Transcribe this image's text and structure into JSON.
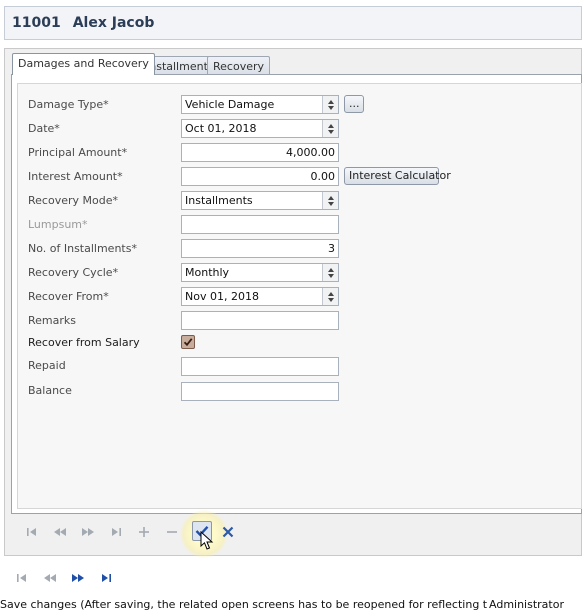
{
  "header": {
    "employee_id": "11001",
    "employee_name": "Alex Jacob"
  },
  "tabs": [
    {
      "label": "Damages and Recovery",
      "active": true
    },
    {
      "label": "Installments",
      "active": false
    },
    {
      "label": "Recovery",
      "active": false
    }
  ],
  "form": {
    "damage_type": {
      "label": "Damage Type*",
      "value": "Vehicle Damage",
      "browse_label": "..."
    },
    "date": {
      "label": "Date*",
      "value": "Oct 01, 2018"
    },
    "principal_amount": {
      "label": "Principal Amount*",
      "value": "4,000.00"
    },
    "interest_amount": {
      "label": "Interest Amount*",
      "value": "0.00",
      "button_label": "Interest Calculator"
    },
    "recovery_mode": {
      "label": "Recovery Mode*",
      "value": "Installments"
    },
    "lumpsum": {
      "label": "Lumpsum*",
      "value": ""
    },
    "installments": {
      "label": "No. of Installments*",
      "value": "3"
    },
    "recovery_cycle": {
      "label": "Recovery Cycle*",
      "value": "Monthly"
    },
    "recover_from": {
      "label": "Recover From*",
      "value": "Nov 01, 2018"
    },
    "remarks": {
      "label": "Remarks",
      "value": ""
    },
    "recover_from_salary": {
      "label": "Recover from Salary",
      "checked": true
    },
    "repaid": {
      "label": "Repaid",
      "value": ""
    },
    "balance": {
      "label": "Balance",
      "value": ""
    }
  },
  "inner_nav": [
    "first-icon",
    "previous-icon",
    "next-icon",
    "last-icon",
    "add-icon",
    "remove-icon",
    "save-check-icon",
    "cancel-x-icon"
  ],
  "outer_nav": [
    "first-icon",
    "previous-icon",
    "next-icon",
    "last-icon"
  ],
  "colors": {
    "accent_blue": "#1f4fa8",
    "check_brown": "#c8ad9d",
    "header_text": "#2c3d57"
  },
  "status_bar": {
    "message": "Save changes (After saving, the related open screens has to be reopened for reflecting the ch",
    "user": "Administrator"
  }
}
